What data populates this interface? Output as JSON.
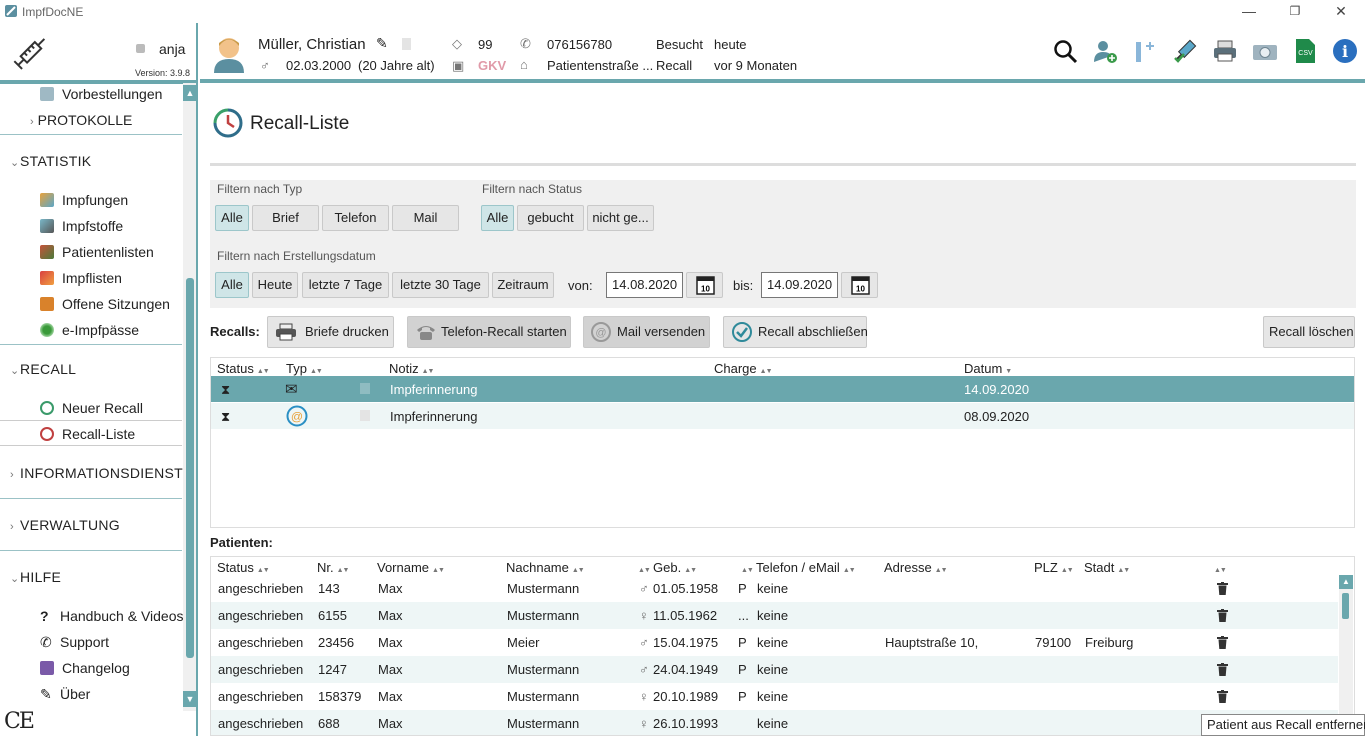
{
  "window": {
    "title": "ImpfDocNE",
    "minimize": "—",
    "restore": "❐",
    "close": "✕"
  },
  "sidebar": {
    "user": "anja",
    "version": "Version: 3.9.8",
    "items": [
      {
        "label": "Vorbestellungen"
      },
      {
        "label": "PROTOKOLLE"
      }
    ],
    "statistik": {
      "label": "STATISTIK",
      "items": [
        {
          "label": "Impfungen"
        },
        {
          "label": "Impfstoffe"
        },
        {
          "label": "Patientenlisten"
        },
        {
          "label": "Impflisten"
        },
        {
          "label": "Offene Sitzungen"
        },
        {
          "label": "e-Impfpässe"
        }
      ]
    },
    "recall": {
      "label": "RECALL",
      "items": [
        {
          "label": "Neuer Recall"
        },
        {
          "label": "Recall-Liste"
        }
      ]
    },
    "informationsdienst": {
      "label": "INFORMATIONSDIENST"
    },
    "verwaltung": {
      "label": "VERWALTUNG"
    },
    "hilfe": {
      "label": "HILFE",
      "items": [
        {
          "label": "Handbuch & Videos"
        },
        {
          "label": "Support"
        },
        {
          "label": "Changelog"
        },
        {
          "label": "Über"
        }
      ]
    },
    "ce_mark": "CE"
  },
  "patient": {
    "name": "Müller, Christian",
    "birthdate": "02.03.2000",
    "age": "(20 Jahre alt)",
    "number": "99",
    "insurance": "GKV",
    "phone": "076156780",
    "address": "Patientenstraße ...",
    "besucht_label": "Besucht",
    "besucht_value": "heute",
    "recall_label": "Recall",
    "recall_value": "vor 9 Monaten"
  },
  "toolbar": {
    "icons": [
      "search-icon",
      "add-patient-icon",
      "add-entry-icon",
      "vaccine-icon",
      "print-icon",
      "camera-icon",
      "csv-export-icon",
      "info-icon"
    ],
    "csv_text": "CSV",
    "info_text": "i"
  },
  "page": {
    "title": "Recall-Liste"
  },
  "filters": {
    "typ_label": "Filtern nach Typ",
    "typ_buttons": [
      "Alle",
      "Brief",
      "Telefon",
      "Mail"
    ],
    "status_label": "Filtern nach Status",
    "status_buttons": [
      "Alle",
      "gebucht",
      "nicht ge..."
    ],
    "datum_label": "Filtern nach Erstellungsdatum",
    "datum_buttons": [
      "Alle",
      "Heute",
      "letzte 7 Tage",
      "letzte 30 Tage",
      "Zeitraum"
    ],
    "von_label": "von:",
    "von_value": "14.08.2020",
    "bis_label": "bis:",
    "bis_value": "14.09.2020",
    "cal_day": "10"
  },
  "recalls": {
    "label": "Recalls:",
    "actions": [
      "Briefe drucken",
      "Telefon-Recall starten",
      "Mail versenden",
      "Recall abschließen"
    ],
    "delete": "Recall löschen",
    "columns": [
      "Status",
      "Typ",
      "Notiz",
      "Charge",
      "Datum"
    ],
    "rows": [
      {
        "status": "hourglass",
        "typ": "letter",
        "notiz": "Impferinnerung",
        "charge": "",
        "datum": "14.09.2020",
        "selected": true
      },
      {
        "status": "hourglass",
        "typ": "mail",
        "notiz": "Impferinnerung",
        "charge": "",
        "datum": "08.09.2020",
        "selected": false
      }
    ]
  },
  "patients": {
    "label": "Patienten:",
    "columns": [
      "Status",
      "Nr.",
      "Vorname",
      "Nachname",
      "Geb.",
      "Telefon / eMail",
      "Adresse",
      "PLZ",
      "Stadt"
    ],
    "rows": [
      {
        "status": "angeschrieben",
        "nr": "143",
        "vorname": "Max",
        "nachname": "Mustermann",
        "sex": "♂",
        "geb": "01.05.1958",
        "p": "P",
        "tel": "keine",
        "adresse": "",
        "plz": "",
        "stadt": ""
      },
      {
        "status": "angeschrieben",
        "nr": "6155",
        "vorname": "Max",
        "nachname": "Mustermann",
        "sex": "♀",
        "geb": "11.05.1962",
        "p": "...",
        "tel": "keine",
        "adresse": "",
        "plz": "",
        "stadt": ""
      },
      {
        "status": "angeschrieben",
        "nr": "23456",
        "vorname": "Max",
        "nachname": "Meier",
        "sex": "♂",
        "geb": "15.04.1975",
        "p": "P",
        "tel": "keine",
        "adresse": "Hauptstraße 10,",
        "plz": "79100",
        "stadt": "Freiburg"
      },
      {
        "status": "angeschrieben",
        "nr": "1247",
        "vorname": "Max",
        "nachname": "Mustermann",
        "sex": "♂",
        "geb": "24.04.1949",
        "p": "P",
        "tel": "keine",
        "adresse": "",
        "plz": "",
        "stadt": ""
      },
      {
        "status": "angeschrieben",
        "nr": "158379",
        "vorname": "Max",
        "nachname": "Mustermann",
        "sex": "♀",
        "geb": "20.10.1989",
        "p": "P",
        "tel": "keine",
        "adresse": "",
        "plz": "",
        "stadt": ""
      },
      {
        "status": "angeschrieben",
        "nr": "688",
        "vorname": "Max",
        "nachname": "Mustermann",
        "sex": "♀",
        "geb": "26.10.1993",
        "p": "",
        "tel": "keine",
        "adresse": "",
        "plz": "",
        "stadt": ""
      }
    ]
  },
  "tooltip": "Patient aus Recall entfernen",
  "colors": {
    "accent": "#6aa7ad",
    "selected_row": "#6aa7ad",
    "alt_row": "#eef6f6",
    "filter_bg": "#f0f0f0"
  }
}
